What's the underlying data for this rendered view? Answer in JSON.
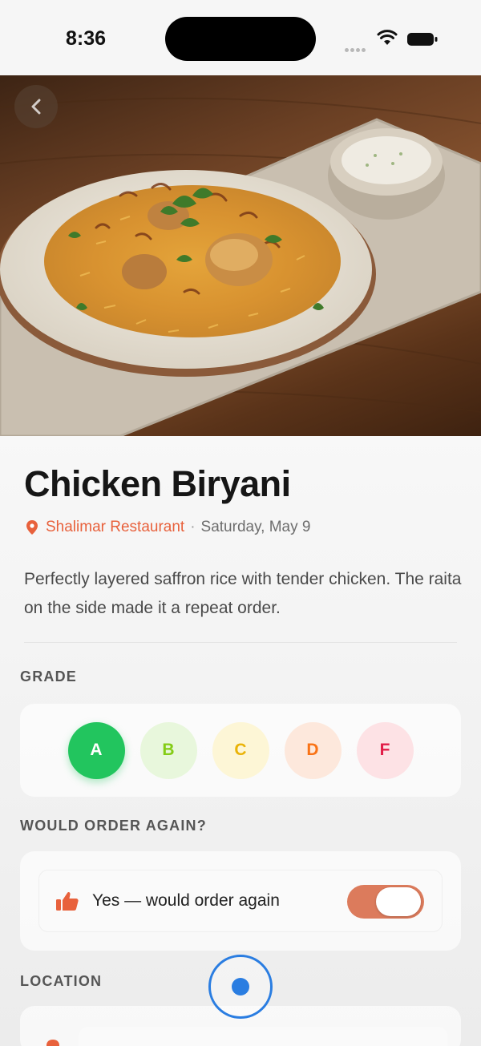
{
  "status_bar": {
    "time": "8:36"
  },
  "dish": {
    "title": "Chicken Biryani",
    "restaurant": "Shalimar Restaurant",
    "separator": "·",
    "date": "Saturday, May 9",
    "description": "Perfectly layered saffron rice with tender chicken. The raita on the side made it a repeat order."
  },
  "grade": {
    "label": "GRADE",
    "selected": "A",
    "options": [
      {
        "letter": "A",
        "bg": "#22c55e",
        "fg": "#ffffff"
      },
      {
        "letter": "B",
        "bg": "#e8f7dc",
        "fg": "#84cc16"
      },
      {
        "letter": "C",
        "bg": "#fdf6d6",
        "fg": "#eab308"
      },
      {
        "letter": "D",
        "bg": "#fde8dc",
        "fg": "#f97316"
      },
      {
        "letter": "F",
        "bg": "#fde2e5",
        "fg": "#e11d48"
      }
    ]
  },
  "order_again": {
    "label": "WOULD ORDER AGAIN?",
    "toggle_label": "Yes — would order again",
    "enabled": true
  },
  "location": {
    "label": "LOCATION"
  },
  "colors": {
    "accent": "#e8613c",
    "toggle_on": "#dc7b5c",
    "fab": "#2a7de1"
  }
}
